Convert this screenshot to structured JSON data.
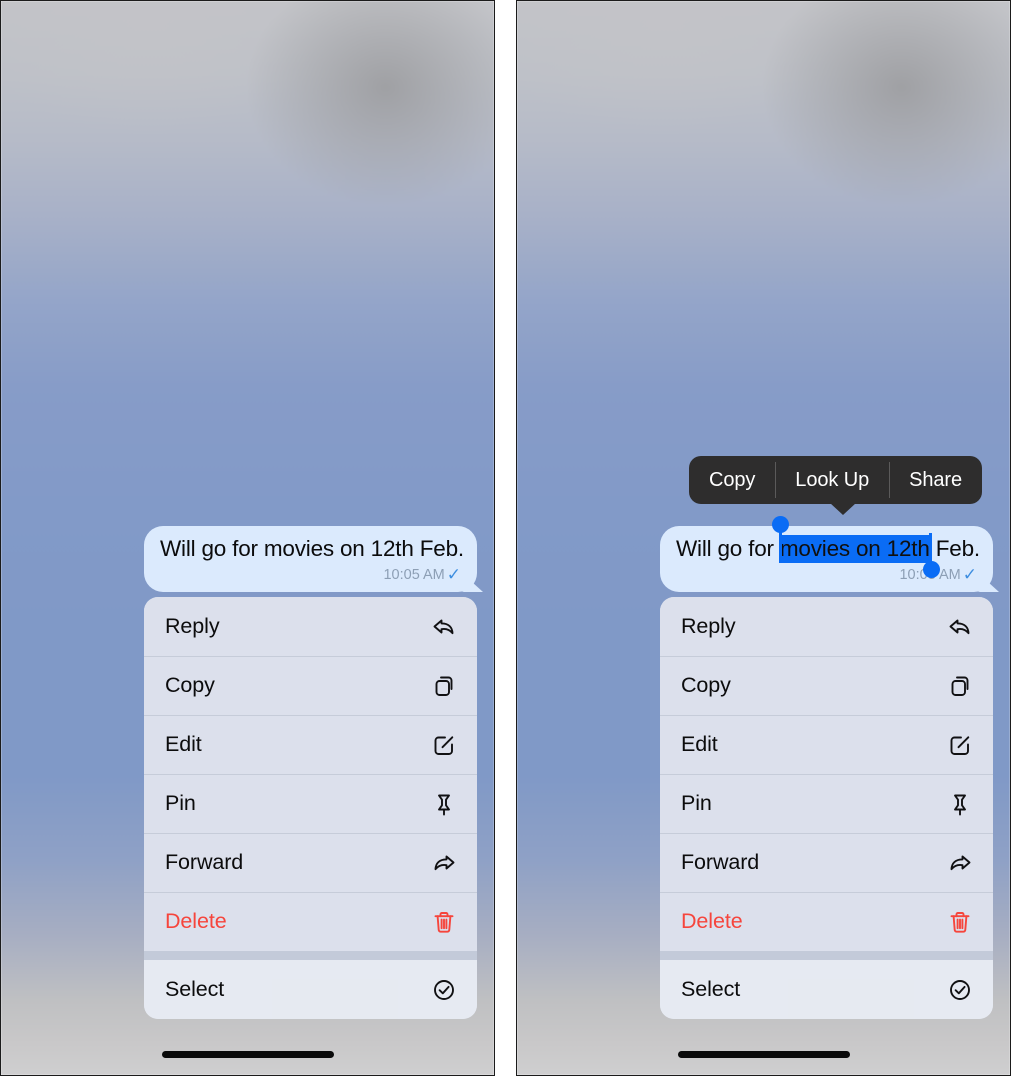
{
  "screens": [
    {
      "name": "left-screen",
      "message": {
        "text": "Will go for movies on 12th Feb.",
        "time": "10:05 AM",
        "status_icon": "checkmark-icon",
        "status_glyph": "✓"
      },
      "context_menu": {
        "groups": [
          {
            "items": [
              {
                "label": "Reply",
                "icon": "reply-arrow-icon",
                "destructive": false
              },
              {
                "label": "Copy",
                "icon": "copy-documents-icon",
                "destructive": false
              },
              {
                "label": "Edit",
                "icon": "pencil-square-icon",
                "destructive": false
              },
              {
                "label": "Pin",
                "icon": "pushpin-icon",
                "destructive": false
              },
              {
                "label": "Forward",
                "icon": "forward-arrow-icon",
                "destructive": false
              },
              {
                "label": "Delete",
                "icon": "trash-icon",
                "destructive": true
              }
            ]
          },
          {
            "items": [
              {
                "label": "Select",
                "icon": "check-circle-icon",
                "destructive": false
              }
            ]
          }
        ]
      }
    },
    {
      "name": "right-screen",
      "edit_toolbar": {
        "items": [
          {
            "label": "Copy"
          },
          {
            "label": "Look Up"
          },
          {
            "label": "Share"
          }
        ]
      },
      "message": {
        "text_before": "Will go for ",
        "text_selected": "movies on 12th",
        "text_after": " Feb.",
        "time": "10:05 AM",
        "status_icon": "checkmark-icon",
        "status_glyph": "✓"
      },
      "context_menu": {
        "groups": [
          {
            "items": [
              {
                "label": "Reply",
                "icon": "reply-arrow-icon",
                "destructive": false
              },
              {
                "label": "Copy",
                "icon": "copy-documents-icon",
                "destructive": false
              },
              {
                "label": "Edit",
                "icon": "pencil-square-icon",
                "destructive": false
              },
              {
                "label": "Pin",
                "icon": "pushpin-icon",
                "destructive": false
              },
              {
                "label": "Forward",
                "icon": "forward-arrow-icon",
                "destructive": false
              },
              {
                "label": "Delete",
                "icon": "trash-icon",
                "destructive": true
              }
            ]
          },
          {
            "items": [
              {
                "label": "Select",
                "icon": "check-circle-icon",
                "destructive": false
              }
            ]
          }
        ]
      }
    }
  ],
  "colors": {
    "bubble_background": "#dbeafd",
    "selection_blue": "#0a6cf5",
    "destructive_red": "#f6453c",
    "toolbar_dark": "#2e2d2d",
    "menu_background": "#dbe0ec",
    "timestamp_gray": "#8d9fb5"
  }
}
